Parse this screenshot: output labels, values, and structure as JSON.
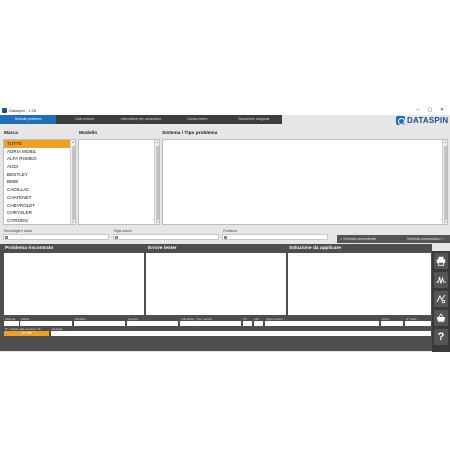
{
  "window": {
    "title": "Dataspin - 1.25",
    "minimize": "–",
    "maximize": "▢",
    "close": "✕"
  },
  "menu": {
    "tabs": [
      "Schede problemi",
      "Dati revisori",
      "Alternative per consultare",
      "Guida errore",
      "Situazione diagnosi"
    ],
    "active_index": 0
  },
  "logo": {
    "text": "DATASPIN",
    "color": "#1c4f8a"
  },
  "marca": {
    "header": "Marca",
    "items": [
      "TUTTE",
      "ADRIA MOBIL",
      "ALFA ROMEO",
      "AUDI",
      "BENTLEY",
      "BMW",
      "CADILLAC",
      "CHATENET",
      "CHEVROLET",
      "CHRYSLER",
      "CITROEN"
    ],
    "selected_index": 0
  },
  "modello": {
    "header": "Modello"
  },
  "sistema": {
    "header": "Sistema / Tipo problema"
  },
  "filters": {
    "codice_label": "Errore/sigle e codici",
    "sigla_label": "Sigla motore",
    "problema_label": "Problema"
  },
  "nav": {
    "prev_label": "< Scheda precedente",
    "next_label": "Scheda successiva >"
  },
  "panels": {
    "problema": "Problema riscontrato",
    "errore": "Errore tester",
    "soluzione": "Soluzione da applicare"
  },
  "details": {
    "labels": [
      "Scheda",
      "Marca",
      "Modello",
      "Gruppo",
      "Cilindrata - Tipo motore",
      "CV",
      "KW",
      "Sigla motore",
      "Anno",
      "N° sede"
    ],
    "numero_label": "N° schede alla versione 15",
    "numero_value": "12.094",
    "commenti_label": "Dettagli"
  },
  "sidebar": {
    "icons": [
      "printer-icon",
      "wave-icon",
      "tune-icon",
      "basket-icon",
      "help-icon"
    ],
    "help_text": "?"
  },
  "colors": {
    "accent": "#1c6fb8",
    "selection": "#f0a020",
    "dark": "#4e4e4e"
  }
}
